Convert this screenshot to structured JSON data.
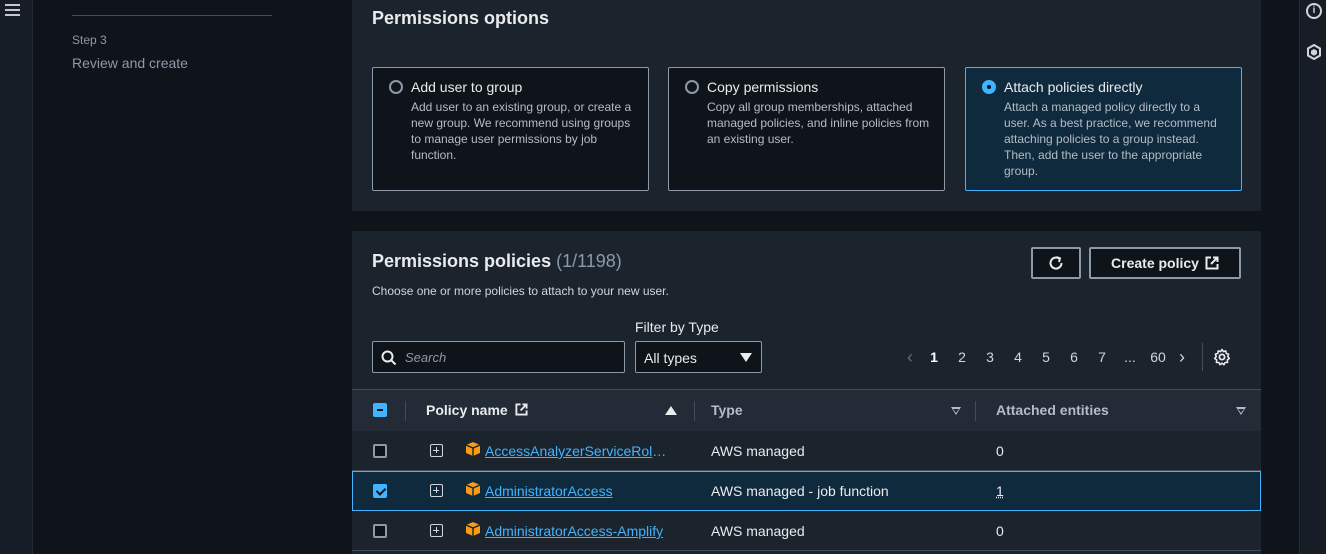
{
  "sidebar": {
    "step_label": "Step 3",
    "step_title": "Review and create"
  },
  "permissions_options": {
    "title": "Permissions options",
    "options": [
      {
        "title": "Add user to group",
        "description": "Add user to an existing group, or create a new group. We recommend using groups to manage user permissions by job function.",
        "selected": false
      },
      {
        "title": "Copy permissions",
        "description": "Copy all group memberships, attached managed policies, and inline policies from an existing user.",
        "selected": false
      },
      {
        "title": "Attach policies directly",
        "description": "Attach a managed policy directly to a user. As a best practice, we recommend attaching policies to a group instead. Then, add the user to the appropriate group.",
        "selected": true
      }
    ]
  },
  "policies": {
    "title": "Permissions policies",
    "count": "(1/1198)",
    "subtitle": "Choose one or more policies to attach to your new user.",
    "create_label": "Create policy",
    "filter_label": "Filter by Type",
    "filter_value": "All types",
    "search_placeholder": "Search",
    "pagination": {
      "current": "1",
      "pages": [
        "1",
        "2",
        "3",
        "4",
        "5",
        "6",
        "7",
        "...",
        "60"
      ]
    },
    "columns": {
      "name": "Policy name",
      "type": "Type",
      "entities": "Attached entities"
    },
    "rows": [
      {
        "name": "AccessAnalyzerServiceRole...",
        "type": "AWS managed",
        "entities": "0",
        "checked": false
      },
      {
        "name": "AdministratorAccess",
        "type": "AWS managed - job function",
        "entities": "1",
        "checked": true
      },
      {
        "name": "AdministratorAccess-Amplify",
        "type": "AWS managed",
        "entities": "0",
        "checked": false
      }
    ]
  },
  "colors": {
    "accent": "#42b4ff",
    "background": "#0f141a",
    "panel": "#1b232d"
  },
  "icons": [
    "menu-icon",
    "info-icon",
    "hexagon-icon",
    "refresh-icon",
    "external-link-icon",
    "search-icon",
    "caret-down-icon",
    "chevron-left-icon",
    "chevron-right-icon",
    "settings-icon",
    "expand-icon",
    "package-icon"
  ]
}
